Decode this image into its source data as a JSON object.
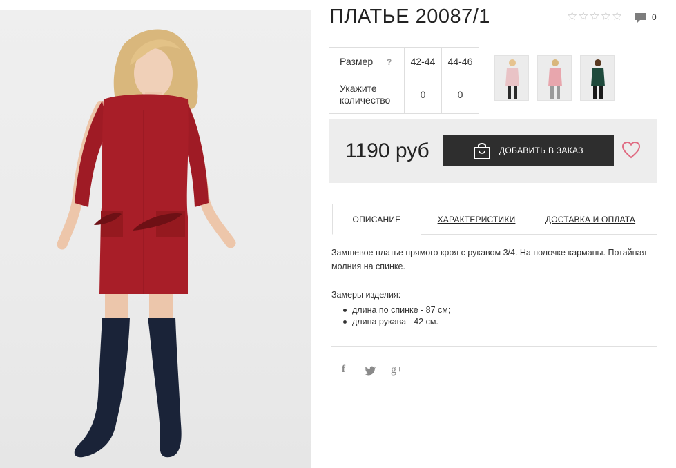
{
  "product": {
    "title": "ПЛАТЬЕ 20087/1",
    "rating_stars": 5,
    "rating_filled": 0,
    "comments_count": "0"
  },
  "size_table": {
    "size_label": "Размер",
    "help_mark": "?",
    "sizes": [
      "42-44",
      "44-46"
    ],
    "qty_label_line1": "Укажите",
    "qty_label_line2": "количество",
    "quantities": [
      "0",
      "0"
    ]
  },
  "thumbnails": [
    {
      "color": "#e9c3c6",
      "name": "pink"
    },
    {
      "color": "#e8a6ad",
      "name": "rose"
    },
    {
      "color": "#1f4a3c",
      "name": "green"
    }
  ],
  "purchase": {
    "price": "1190 руб",
    "order_button": "ДОБАВИТЬ В ЗАКАЗ",
    "button_color": "#2e2e2e",
    "heart_color": "#e06b82"
  },
  "tabs": [
    {
      "label": "ОПИСАНИЕ",
      "active": true
    },
    {
      "label": "ХАРАКТЕРИСТИКИ",
      "active": false
    },
    {
      "label": "ДОСТАВКА И ОПЛАТА",
      "active": false
    }
  ],
  "description": {
    "text": "Замшевое платье прямого кроя с рукавом 3/4. На полочке карманы. Потайная молния на спинке.",
    "measures_title": "Замеры изделия:",
    "measures": [
      "длина по спинке - 87 см;",
      "длина рукава - 42 см."
    ]
  },
  "social": {
    "facebook": "f",
    "twitter": "🐦",
    "google_plus": "g+"
  },
  "colors": {
    "dress": "#a81e28",
    "boots": "#1a2338"
  }
}
